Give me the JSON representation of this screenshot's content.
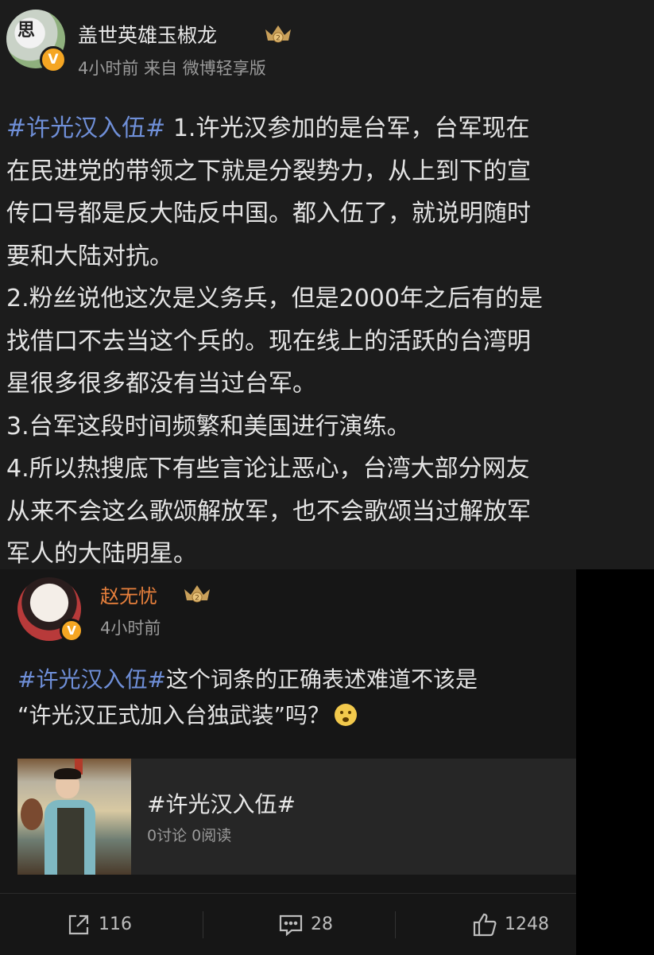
{
  "post1": {
    "username": "盖世英雄玉椒龙",
    "avatar_text": "思",
    "verified": "V",
    "meta": "4小时前 来自 微博轻享版",
    "hashtag": "#许光汉入伍#",
    "lines": [
      " 1.许光汉参加的是台军，台军现在",
      "在民进党的带领之下就是分裂势力，从上到下的宣",
      "传口号都是反大陆反中国。都入伍了，就说明随时",
      "要和大陆对抗。",
      "2.粉丝说他这次是义务兵，但是2000年之后有的是",
      "找借口不去当这个兵的。现在线上的活跃的台湾明",
      "星很多很多都没有当过台军。",
      "3.台军这段时间频繁和美国进行演练。",
      "4.所以热搜底下有些言论让恶心，台湾大部分网友",
      "从来不会这么歌颂解放军，也不会歌颂当过解放军",
      "军人的大陆明星。"
    ]
  },
  "post2": {
    "username": "赵无忧",
    "verified": "V",
    "meta": "4小时前",
    "hashtag": "#许光汉入伍#",
    "line1": "这个词条的正确表述难道不该是",
    "line2": "“许光汉正式加入台独武装”吗？",
    "card": {
      "title": "#许光汉入伍#",
      "stats": "0讨论 0阅读"
    }
  },
  "actions": {
    "repost_count": "116",
    "comment_count": "28",
    "like_count": "1248"
  },
  "colors": {
    "hashtag": "#6f8fd8",
    "username_highlight": "#e8803c",
    "verified_badge": "#f5a623"
  },
  "icons": [
    "repost-icon",
    "comment-icon",
    "like-icon",
    "crown-badge-icon",
    "verified-icon"
  ]
}
